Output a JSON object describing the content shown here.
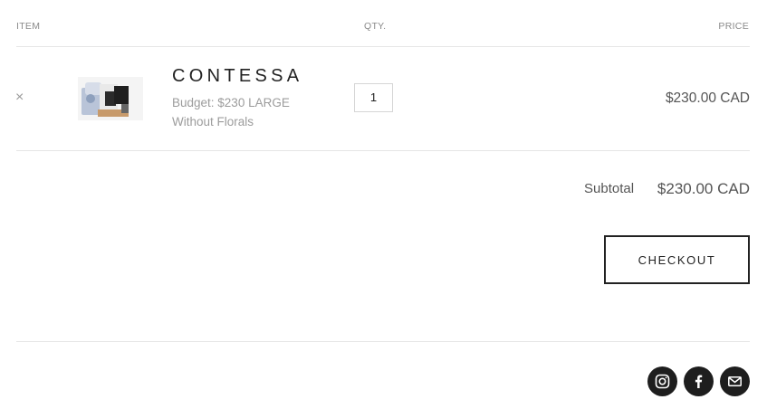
{
  "table_header": {
    "item": "ITEM",
    "qty": "QTY.",
    "price": "PRICE"
  },
  "cart_item": {
    "remove_glyph": "×",
    "name": "CONTESSA",
    "variant_line1": "Budget: $230 LARGE",
    "variant_line2": "Without Florals",
    "quantity": "1",
    "price": "$230.00 CAD"
  },
  "summary": {
    "subtotal_label": "Subtotal",
    "subtotal_value": "$230.00 CAD"
  },
  "checkout_label": "CHECKOUT",
  "social": {
    "icons": [
      "instagram-icon",
      "facebook-icon",
      "email-icon"
    ],
    "bg_color": "#1e1e1e",
    "icon_color": "#ffffff"
  }
}
